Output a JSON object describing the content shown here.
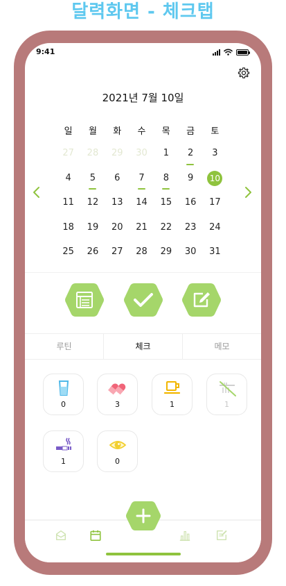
{
  "page_heading": "달력화면 - 체크탭",
  "status_bar": {
    "time": "9:41"
  },
  "calendar": {
    "title": "2021년 7월 10일",
    "weekdays": [
      "일",
      "월",
      "화",
      "수",
      "목",
      "금",
      "토"
    ],
    "days": [
      {
        "label": "27",
        "muted": true
      },
      {
        "label": "28",
        "muted": true
      },
      {
        "label": "29",
        "muted": true
      },
      {
        "label": "30",
        "muted": true
      },
      {
        "label": "1"
      },
      {
        "label": "2",
        "marked": true
      },
      {
        "label": "3"
      },
      {
        "label": "4"
      },
      {
        "label": "5",
        "marked": true
      },
      {
        "label": "6"
      },
      {
        "label": "7",
        "marked": true
      },
      {
        "label": "8",
        "marked": true
      },
      {
        "label": "9"
      },
      {
        "label": "10",
        "selected": true
      },
      {
        "label": "11"
      },
      {
        "label": "12"
      },
      {
        "label": "13"
      },
      {
        "label": "14"
      },
      {
        "label": "15"
      },
      {
        "label": "16"
      },
      {
        "label": "17"
      },
      {
        "label": "18"
      },
      {
        "label": "19"
      },
      {
        "label": "20"
      },
      {
        "label": "21"
      },
      {
        "label": "22"
      },
      {
        "label": "23"
      },
      {
        "label": "24"
      },
      {
        "label": "25"
      },
      {
        "label": "26"
      },
      {
        "label": "27"
      },
      {
        "label": "28"
      },
      {
        "label": "29"
      },
      {
        "label": "30"
      },
      {
        "label": "31"
      }
    ]
  },
  "action_buttons": [
    {
      "name": "routine-button",
      "icon": "list-icon"
    },
    {
      "name": "check-button",
      "icon": "check-icon"
    },
    {
      "name": "memo-button",
      "icon": "edit-icon"
    }
  ],
  "tabs": [
    {
      "label": "루틴",
      "active": false
    },
    {
      "label": "체크",
      "active": true
    },
    {
      "label": "메모",
      "active": false
    }
  ],
  "check_items": [
    {
      "icon": "water-cup-icon",
      "count": "0",
      "disabled": false
    },
    {
      "icon": "pill-icon",
      "count": "3",
      "disabled": false
    },
    {
      "icon": "coffee-cup-icon",
      "count": "1",
      "disabled": false
    },
    {
      "icon": "toothbrush-icon",
      "count": "1",
      "disabled": true
    },
    {
      "icon": "cigarette-icon",
      "count": "1",
      "disabled": false
    },
    {
      "icon": "eye-icon",
      "count": "0",
      "disabled": false
    }
  ],
  "bottom_nav": [
    {
      "icon": "inbox-icon",
      "active": false
    },
    {
      "icon": "calendar-icon",
      "active": true
    },
    {
      "icon": "bar-chart-icon",
      "active": false
    },
    {
      "icon": "notes-icon",
      "active": false
    }
  ],
  "colors": {
    "heading": "#5ec8ef",
    "phone_frame": "#b87a7a",
    "accent_green": "#8fc33e",
    "hex_green": "#a5d66a"
  }
}
